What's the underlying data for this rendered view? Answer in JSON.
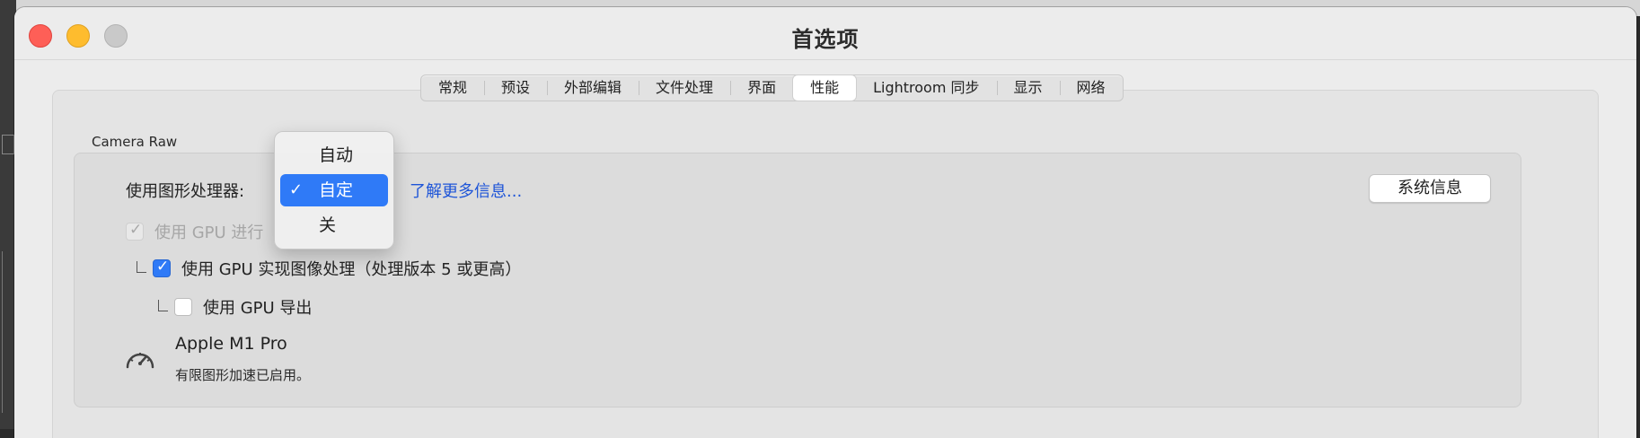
{
  "window": {
    "title": "首选项"
  },
  "tabs": [
    {
      "label": "常规",
      "active": false
    },
    {
      "label": "预设",
      "active": false
    },
    {
      "label": "外部编辑",
      "active": false
    },
    {
      "label": "文件处理",
      "active": false
    },
    {
      "label": "界面",
      "active": false
    },
    {
      "label": "性能",
      "active": true
    },
    {
      "label": "Lightroom 同步",
      "active": false
    },
    {
      "label": "显示",
      "active": false
    },
    {
      "label": "网络",
      "active": false
    }
  ],
  "camera_raw": {
    "section_title": "Camera Raw",
    "gpu_label": "使用图形处理器:",
    "gpu_options": [
      "自动",
      "自定",
      "关"
    ],
    "gpu_selected": "自定",
    "learn_more": "了解更多信息...",
    "system_info_button": "系统信息",
    "display_option": {
      "label": "使用 GPU 进行",
      "checked": true,
      "enabled": false
    },
    "image_processing_option": {
      "label": "使用 GPU 实现图像处理（处理版本 5 或更高）",
      "checked": true,
      "enabled": true
    },
    "export_option": {
      "label": "使用 GPU 导出",
      "checked": false,
      "enabled": true
    },
    "gpu_name": "Apple M1 Pro",
    "gpu_status": "有限图形加速已启用。"
  },
  "colors": {
    "accent": "#2f7af7",
    "link": "#1e55d8"
  },
  "icons": {
    "selected_check": "✓",
    "gauge": "gauge-icon"
  }
}
